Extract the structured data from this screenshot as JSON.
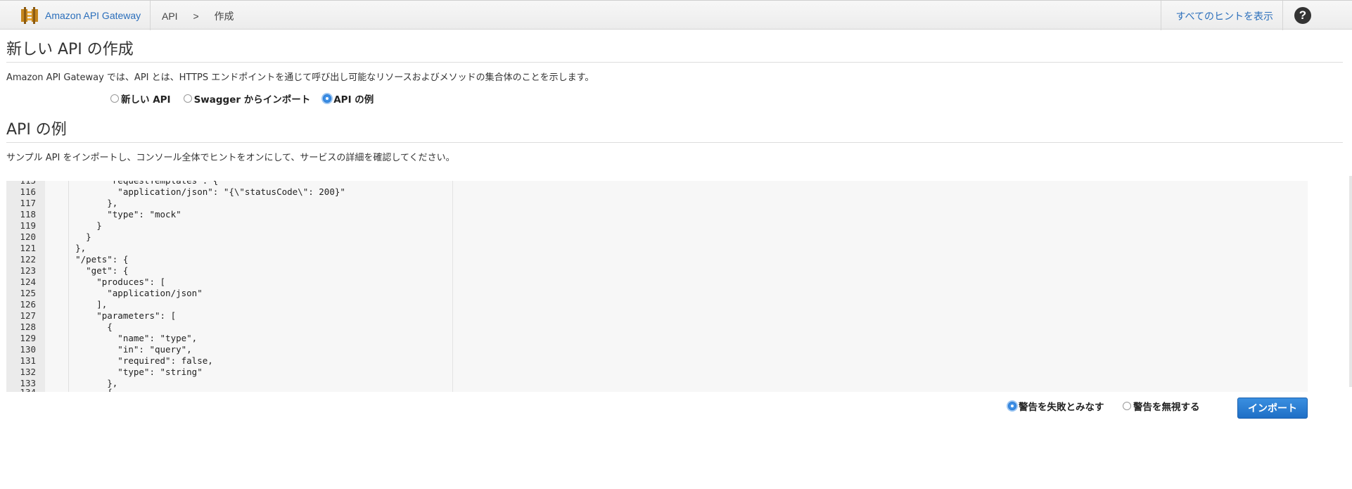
{
  "header": {
    "brand": "Amazon API Gateway",
    "breadcrumb": [
      "API",
      ">",
      "作成"
    ],
    "hints_link": "すべてのヒントを表示",
    "help_icon": "?"
  },
  "page": {
    "title": "新しい API の作成",
    "description": "Amazon API Gateway では、API とは、HTTPS エンドポイントを通じて呼び出し可能なリソースおよびメソッドの集合体のことを示します。",
    "options": [
      {
        "label": "新しい API",
        "checked": false
      },
      {
        "label": "Swagger からインポート",
        "checked": false
      },
      {
        "label": "API の例",
        "checked": true
      }
    ]
  },
  "example": {
    "title": "API の例",
    "description": "サンプル API をインポートし、コンソール全体でヒントをオンにして、サービスの詳細を確認してください。"
  },
  "editor": {
    "lines": [
      {
        "n": "116",
        "text": "            \"application/json\": \"{\\\"statusCode\\\": 200}\""
      },
      {
        "n": "117",
        "text": "          },"
      },
      {
        "n": "118",
        "text": "          \"type\": \"mock\""
      },
      {
        "n": "119",
        "text": "        }"
      },
      {
        "n": "120",
        "text": "      }"
      },
      {
        "n": "121",
        "text": "    },"
      },
      {
        "n": "122",
        "text": "    \"/pets\": {"
      },
      {
        "n": "123",
        "text": "      \"get\": {"
      },
      {
        "n": "124",
        "text": "        \"produces\": ["
      },
      {
        "n": "125",
        "text": "          \"application/json\""
      },
      {
        "n": "126",
        "text": "        ],"
      },
      {
        "n": "127",
        "text": "        \"parameters\": ["
      },
      {
        "n": "128",
        "text": "          {"
      },
      {
        "n": "129",
        "text": "            \"name\": \"type\","
      },
      {
        "n": "130",
        "text": "            \"in\": \"query\","
      },
      {
        "n": "131",
        "text": "            \"required\": false,"
      },
      {
        "n": "132",
        "text": "            \"type\": \"string\""
      },
      {
        "n": "133",
        "text": "          },"
      }
    ]
  },
  "footer": {
    "options": [
      {
        "label": "警告を失敗とみなす",
        "checked": true
      },
      {
        "label": "警告を無視する",
        "checked": false
      }
    ],
    "import_button": "インポート"
  },
  "colors": {
    "link": "#2a6ebb",
    "primary_button": "#1f6fc6"
  }
}
